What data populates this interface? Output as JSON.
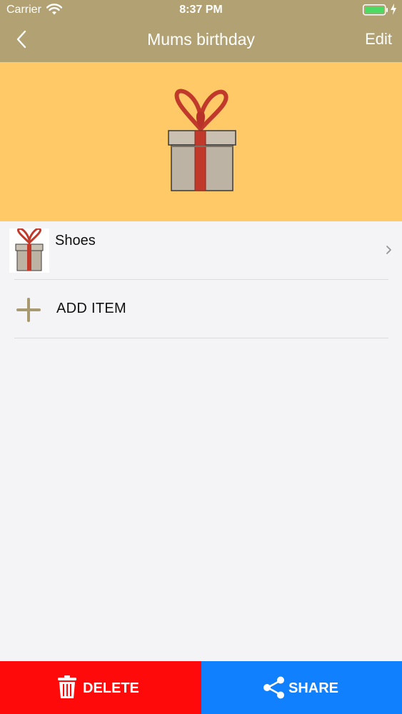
{
  "status_bar": {
    "carrier": "Carrier",
    "time": "8:37 PM"
  },
  "nav": {
    "title": "Mums birthday",
    "edit_label": "Edit",
    "back_icon": "chevron-left-icon"
  },
  "colors": {
    "header_bg": "#b2a173",
    "hero_bg": "#fec966",
    "delete_bg": "#fe0a0a",
    "share_bg": "#1180fe",
    "battery_fill": "#4cd964"
  },
  "hero": {
    "icon": "gift-icon"
  },
  "list": {
    "items": [
      {
        "label": "Shoes",
        "icon": "gift-icon"
      }
    ],
    "add_label": "ADD ITEM"
  },
  "footer": {
    "delete_label": "DELETE",
    "share_label": "SHARE"
  }
}
